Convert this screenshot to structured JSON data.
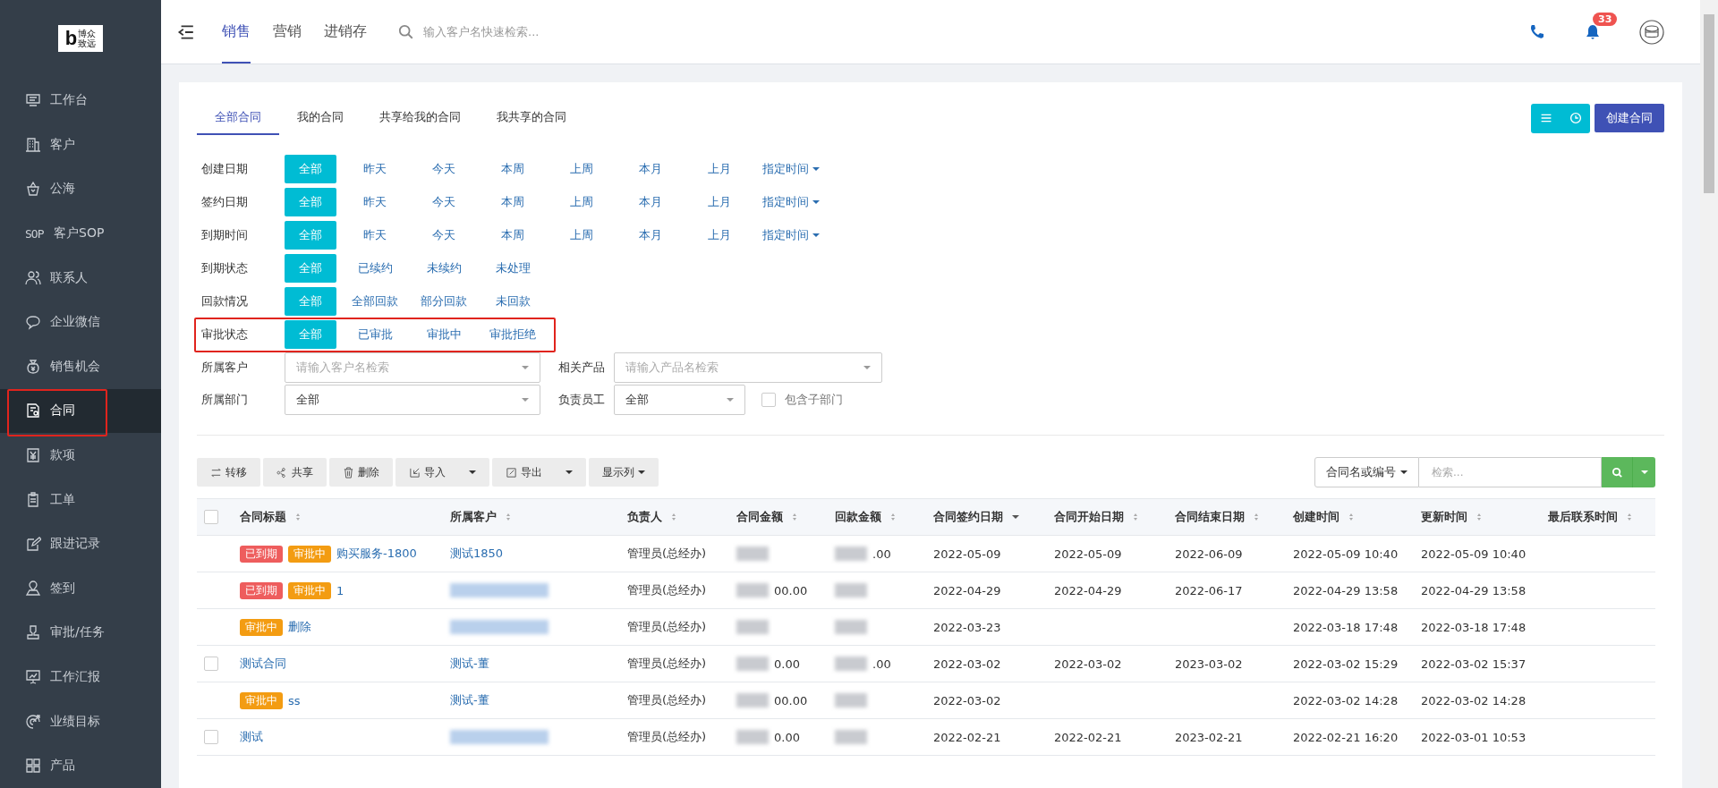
{
  "logo": {
    "mark": "b",
    "lines": [
      "博众",
      "致远"
    ]
  },
  "sidebar": {
    "items": [
      {
        "label": "工作台",
        "selected": false,
        "highlighted": false
      },
      {
        "label": "客户",
        "selected": false,
        "highlighted": false
      },
      {
        "label": "公海",
        "selected": false,
        "highlighted": false
      },
      {
        "label": "客户SOP",
        "icon_text": "SOP",
        "selected": false,
        "highlighted": false
      },
      {
        "label": "联系人",
        "selected": false,
        "highlighted": false
      },
      {
        "label": "企业微信",
        "selected": false,
        "highlighted": false
      },
      {
        "label": "销售机会",
        "selected": false,
        "highlighted": false
      },
      {
        "label": "合同",
        "selected": true,
        "highlighted": true
      },
      {
        "label": "款项",
        "selected": false,
        "highlighted": false
      },
      {
        "label": "工单",
        "selected": false,
        "highlighted": false
      },
      {
        "label": "跟进记录",
        "selected": false,
        "highlighted": false
      },
      {
        "label": "签到",
        "selected": false,
        "highlighted": false
      },
      {
        "label": "审批/任务",
        "selected": false,
        "highlighted": false
      },
      {
        "label": "工作汇报",
        "selected": false,
        "highlighted": false
      },
      {
        "label": "业绩目标",
        "selected": false,
        "highlighted": false
      },
      {
        "label": "产品",
        "selected": false,
        "highlighted": false
      }
    ]
  },
  "header": {
    "nav": [
      {
        "label": "销售",
        "selected": true
      },
      {
        "label": "营销",
        "selected": false
      },
      {
        "label": "进销存",
        "selected": false
      }
    ],
    "search": {
      "placeholder": "输入客户名快速检索..."
    },
    "notification_count": "33"
  },
  "tabs": [
    {
      "label": "全部合同",
      "selected": true
    },
    {
      "label": "我的合同",
      "selected": false
    },
    {
      "label": "共享给我的合同",
      "selected": false
    },
    {
      "label": "我共享的合同",
      "selected": false
    }
  ],
  "create_button": "创建合同",
  "filters": [
    {
      "label": "创建日期",
      "highlighted": false,
      "options": [
        {
          "label": "全部",
          "selected": true
        },
        {
          "label": "昨天",
          "selected": false
        },
        {
          "label": "今天",
          "selected": false
        },
        {
          "label": "本周",
          "selected": false
        },
        {
          "label": "上周",
          "selected": false
        },
        {
          "label": "本月",
          "selected": false
        },
        {
          "label": "上月",
          "selected": false
        },
        {
          "label": "指定时间",
          "selected": false,
          "kind": "dropdown"
        }
      ]
    },
    {
      "label": "签约日期",
      "highlighted": false,
      "options": [
        {
          "label": "全部",
          "selected": true
        },
        {
          "label": "昨天",
          "selected": false
        },
        {
          "label": "今天",
          "selected": false
        },
        {
          "label": "本周",
          "selected": false
        },
        {
          "label": "上周",
          "selected": false
        },
        {
          "label": "本月",
          "selected": false
        },
        {
          "label": "上月",
          "selected": false
        },
        {
          "label": "指定时间",
          "selected": false,
          "kind": "dropdown"
        }
      ]
    },
    {
      "label": "到期时间",
      "highlighted": false,
      "options": [
        {
          "label": "全部",
          "selected": true
        },
        {
          "label": "昨天",
          "selected": false
        },
        {
          "label": "今天",
          "selected": false
        },
        {
          "label": "本周",
          "selected": false
        },
        {
          "label": "上周",
          "selected": false
        },
        {
          "label": "本月",
          "selected": false
        },
        {
          "label": "上月",
          "selected": false
        },
        {
          "label": "指定时间",
          "selected": false,
          "kind": "dropdown"
        }
      ]
    },
    {
      "label": "到期状态",
      "highlighted": false,
      "options": [
        {
          "label": "全部",
          "selected": true
        },
        {
          "label": "已续约",
          "selected": false
        },
        {
          "label": "未续约",
          "selected": false
        },
        {
          "label": "未处理",
          "selected": false
        }
      ]
    },
    {
      "label": "回款情况",
      "highlighted": false,
      "options": [
        {
          "label": "全部",
          "selected": true
        },
        {
          "label": "全部回款",
          "selected": false
        },
        {
          "label": "部分回款",
          "selected": false
        },
        {
          "label": "未回款",
          "selected": false
        }
      ]
    },
    {
      "label": "审批状态",
      "highlighted": true,
      "options": [
        {
          "label": "全部",
          "selected": true
        },
        {
          "label": "已审批",
          "selected": false
        },
        {
          "label": "审批中",
          "selected": false
        },
        {
          "label": "审批拒绝",
          "selected": false
        }
      ]
    }
  ],
  "selects": [
    {
      "label": "所属客户",
      "placeholder": "请输入客户名检索"
    },
    {
      "label": "相关产品",
      "placeholder": "请输入产品名检索"
    },
    {
      "label": "所属部门",
      "value": "全部"
    },
    {
      "label": "负责员工",
      "value": "全部"
    }
  ],
  "include_sub": {
    "label": "包含子部门",
    "checked": false
  },
  "toolbar": [
    {
      "label": "转移",
      "kind": "plain"
    },
    {
      "label": "共享",
      "kind": "plain"
    },
    {
      "label": "删除",
      "kind": "plain"
    },
    {
      "label": "导入",
      "kind": "split"
    },
    {
      "label": "导出",
      "kind": "split"
    },
    {
      "label": "显示列",
      "kind": "menu"
    }
  ],
  "table_search": {
    "field": "合同名或编号",
    "placeholder": "检索..."
  },
  "table": {
    "all_checked": false,
    "columns": [
      {
        "label": "合同标题",
        "sorted": false
      },
      {
        "label": "所属客户",
        "sorted": false
      },
      {
        "label": "负责人",
        "sorted": false
      },
      {
        "label": "合同金额",
        "sorted": false
      },
      {
        "label": "回款金额",
        "sorted": false
      },
      {
        "label": "合同签约日期",
        "sorted": true
      },
      {
        "label": "合同开始日期",
        "sorted": false
      },
      {
        "label": "合同结束日期",
        "sorted": false
      },
      {
        "label": "创建时间",
        "sorted": false
      },
      {
        "label": "更新时间",
        "sorted": false
      },
      {
        "label": "最后联系时间",
        "sorted": false
      }
    ],
    "rows": [
      {
        "tags": [
          {
            "text": "已到期",
            "color": "#ee5d5d"
          },
          {
            "text": "审批中",
            "color": "#f39c12"
          }
        ],
        "title": "购买服务-1800",
        "customer": {
          "text": "测试1850",
          "redacted": false
        },
        "owner": "管理员(总经办)",
        "amount": {
          "redacted": true
        },
        "paid": {
          "text": ".00",
          "redacted": true
        },
        "signed": "2022-05-09",
        "start": "2022-05-09",
        "end": "2022-06-09",
        "created": "2022-05-09 10:40",
        "updated": "2022-05-09 10:40"
      },
      {
        "tags": [
          {
            "text": "已到期",
            "color": "#ee5d5d"
          },
          {
            "text": "审批中",
            "color": "#f39c12"
          }
        ],
        "title": "1",
        "customer": {
          "redacted": true
        },
        "owner": "管理员(总经办)",
        "amount": {
          "text": "00.00",
          "redacted": true
        },
        "paid": {
          "redacted": true
        },
        "signed": "2022-04-29",
        "start": "2022-04-29",
        "end": "2022-06-17",
        "created": "2022-04-29 13:58",
        "updated": "2022-04-29 13:58"
      },
      {
        "tags": [
          {
            "text": "审批中",
            "color": "#f39c12"
          }
        ],
        "title": "删除",
        "customer": {
          "redacted": true
        },
        "owner": "管理员(总经办)",
        "amount": {
          "redacted": true
        },
        "paid": {
          "redacted": true
        },
        "signed": "2022-03-23",
        "created": "2022-03-18 17:48",
        "updated": "2022-03-18 17:48"
      },
      {
        "checked": false,
        "title": "测试合同",
        "customer": {
          "text": "测试-董",
          "redacted": false
        },
        "owner": "管理员(总经办)",
        "amount": {
          "text": "0.00",
          "redacted": true
        },
        "paid": {
          "text": ".00",
          "redacted": true
        },
        "signed": "2022-03-02",
        "start": "2022-03-02",
        "end": "2023-03-02",
        "created": "2022-03-02 15:29",
        "updated": "2022-03-02 15:37"
      },
      {
        "tags": [
          {
            "text": "审批中",
            "color": "#f39c12"
          }
        ],
        "title": "ss",
        "customer": {
          "text": "测试-董",
          "redacted": false
        },
        "owner": "管理员(总经办)",
        "amount": {
          "text": "00.00",
          "redacted": true
        },
        "paid": {
          "redacted": true
        },
        "signed": "2022-03-02",
        "created": "2022-03-02 14:28",
        "updated": "2022-03-02 14:28"
      },
      {
        "checked": false,
        "title": "测试",
        "customer": {
          "redacted": true
        },
        "owner": "管理员(总经办)",
        "amount": {
          "text": "0.00",
          "redacted": true
        },
        "paid": {
          "redacted": true
        },
        "signed": "2022-02-21",
        "start": "2022-02-21",
        "end": "2023-02-21",
        "created": "2022-02-21 16:20",
        "updated": "2022-03-01 10:53"
      }
    ]
  }
}
